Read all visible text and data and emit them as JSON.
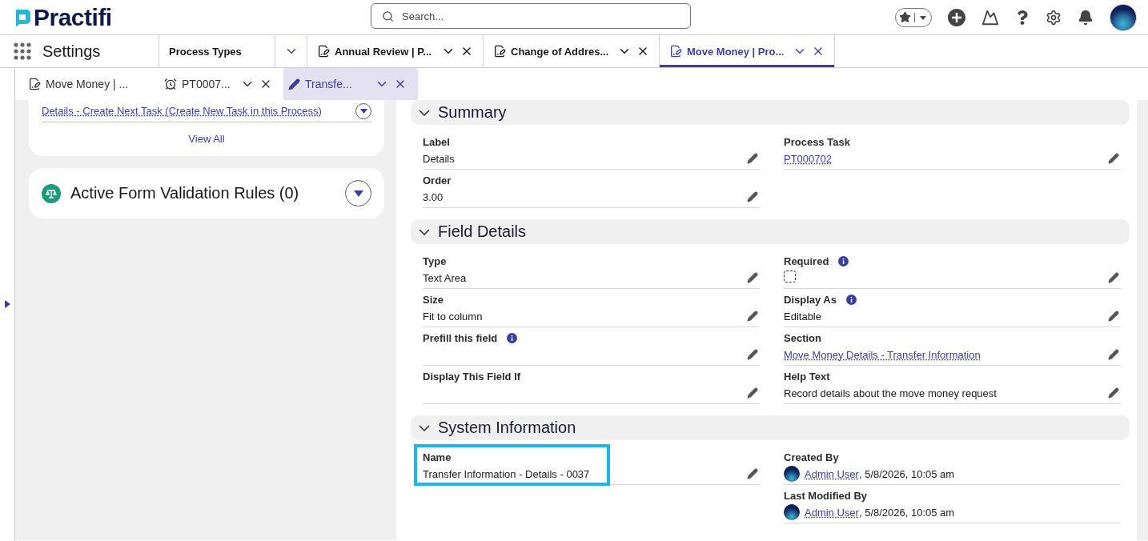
{
  "header": {
    "logo": "Practifi",
    "search": {
      "placeholder": "Search..."
    }
  },
  "nav": {
    "app_name": "Settings",
    "tabs": [
      {
        "label": "Process Types",
        "kind": "object",
        "selected": false
      },
      {
        "label": "Annual Review | P...",
        "kind": "record",
        "selected": false
      },
      {
        "label": "Change of Addres...",
        "kind": "record",
        "selected": false
      },
      {
        "label": "Move Money | Pro...",
        "kind": "record",
        "selected": true
      }
    ]
  },
  "subtabs": [
    {
      "label": "Move Money | ...",
      "kind": "record",
      "closable": false,
      "selected": false
    },
    {
      "label": "PT0007...",
      "kind": "alarm",
      "closable": true,
      "selected": false
    },
    {
      "label": "Transfe...",
      "kind": "edit",
      "closable": true,
      "selected": true
    }
  ],
  "related_list": {
    "link": "Details - Create Next Task (Create New Task in this Process)",
    "view_all": "View All"
  },
  "validation_card": {
    "title": "Active Form Validation Rules (0)",
    "expanded": false
  },
  "sections": [
    {
      "title": "Summary",
      "expanded": true,
      "left": [
        {
          "label": "Label",
          "kind": "text",
          "value": "Details",
          "info": false,
          "editable": true,
          "highlighted": false
        },
        {
          "label": "Order",
          "kind": "text",
          "value": "3.00",
          "info": false,
          "editable": true,
          "highlighted": false
        }
      ],
      "right": [
        {
          "label": "Process Task",
          "kind": "link",
          "value": "PT000702",
          "info": false,
          "editable": true,
          "highlighted": false
        }
      ]
    },
    {
      "title": "Field Details",
      "expanded": true,
      "left": [
        {
          "label": "Type",
          "kind": "text",
          "value": "Text Area",
          "info": false,
          "editable": true,
          "highlighted": false
        },
        {
          "label": "Size",
          "kind": "text",
          "value": "Fit to column",
          "info": false,
          "editable": true,
          "highlighted": false
        },
        {
          "label": "Prefill this field",
          "kind": "text",
          "info": true,
          "editable": true,
          "highlighted": false
        },
        {
          "label": "Display This Field If",
          "kind": "text",
          "info": false,
          "editable": true,
          "highlighted": false
        }
      ],
      "right": [
        {
          "label": "Required",
          "kind": "checkbox",
          "checked": false,
          "info": true,
          "editable": true,
          "highlighted": false
        },
        {
          "label": "Display As",
          "kind": "text",
          "value": "Editable",
          "info": true,
          "editable": true,
          "highlighted": false
        },
        {
          "label": "Section",
          "kind": "link",
          "value": "Move Money Details - Transfer Information",
          "info": false,
          "editable": true,
          "highlighted": false
        },
        {
          "label": "Help Text",
          "kind": "text",
          "value": "Record details about the move money request",
          "info": false,
          "editable": true,
          "highlighted": false
        }
      ]
    },
    {
      "title": "System Information",
      "expanded": true,
      "left": [
        {
          "label": "Name",
          "kind": "text",
          "value": "Transfer Information - Details - 0037",
          "info": false,
          "editable": true,
          "highlighted": true
        }
      ],
      "right": [
        {
          "label": "Created By",
          "kind": "user",
          "value": "Admin User",
          "detail": ", 5/8/2026, 10:05 am",
          "info": false,
          "editable": false,
          "highlighted": false
        },
        {
          "label": "Last Modified By",
          "kind": "user",
          "value": "Admin User",
          "detail": ", 5/8/2026, 10:05 am",
          "info": false,
          "editable": false,
          "highlighted": false
        }
      ]
    }
  ]
}
